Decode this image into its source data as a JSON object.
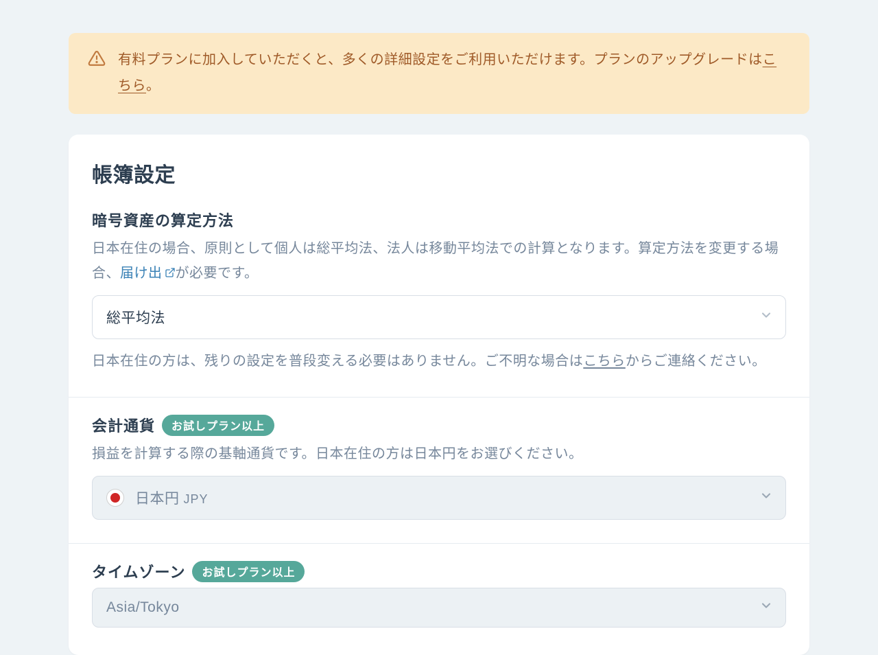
{
  "alert": {
    "text_before": "有料プランに加入していただくと、多くの詳細設定をご利用いただけます。プランのアップグレードは",
    "link": "こちら",
    "text_after": "。"
  },
  "card": {
    "title": "帳簿設定",
    "calc": {
      "heading": "暗号資産の算定方法",
      "desc_before": "日本在住の場合、原則として個人は総平均法、法人は移動平均法での計算となります。算定方法を変更する場合、",
      "desc_link": "届け出",
      "desc_after": "が必要です。",
      "select_value": "総平均法",
      "note_before": "日本在住の方は、残りの設定を普段変える必要はありません。ご不明な場合は",
      "note_link": "こちら",
      "note_after": "からご連絡ください。"
    },
    "currency": {
      "heading": "会計通貨",
      "badge": "お試しプラン以上",
      "desc": "損益を計算する際の基軸通貨です。日本在住の方は日本円をお選びください。",
      "select_name": "日本円",
      "select_code": "JPY"
    },
    "timezone": {
      "heading": "タイムゾーン",
      "badge": "お試しプラン以上",
      "select_value": "Asia/Tokyo"
    }
  },
  "colors": {
    "alert_bg": "#fce9c6",
    "alert_fg": "#9f5a28",
    "badge_bg": "#56a89a",
    "link": "#3b82b6"
  }
}
